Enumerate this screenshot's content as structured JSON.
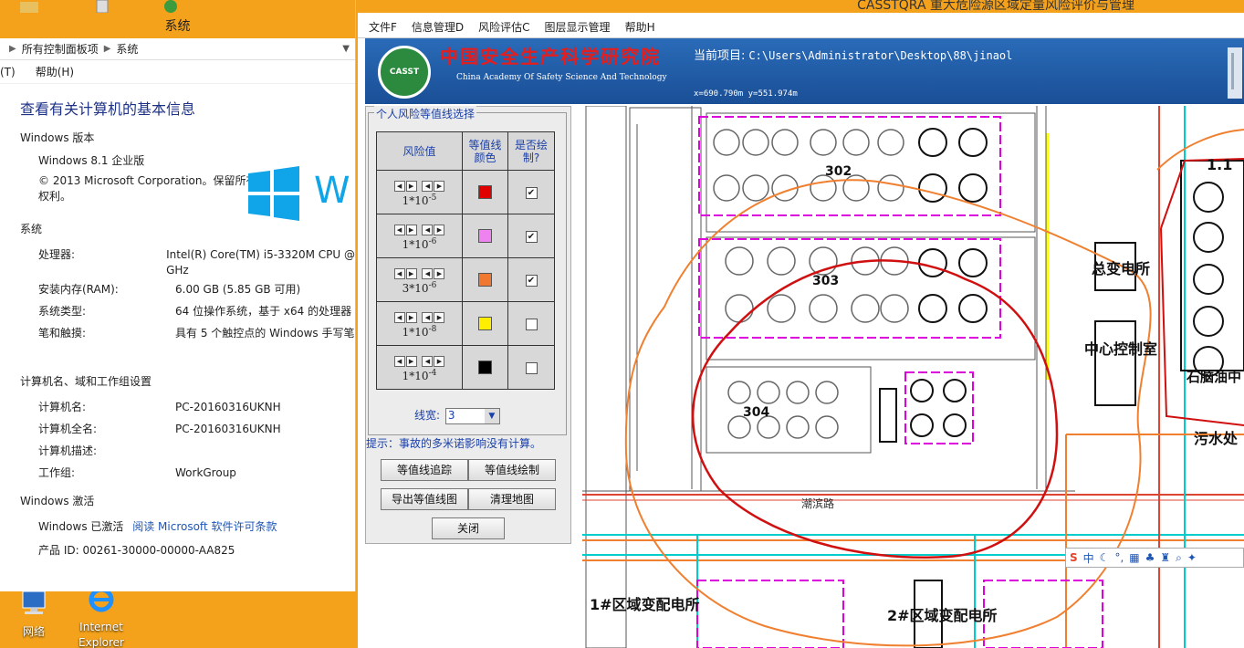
{
  "desktop": {
    "icons": [
      {
        "label": "网络"
      },
      {
        "label": "Internet\nExplorer"
      }
    ]
  },
  "system": {
    "window_title": "系统",
    "breadcrumb": [
      "所有控制面板项",
      "系统"
    ],
    "menu": [
      "(T)",
      "帮助(H)"
    ],
    "heading": "查看有关计算机的基本信息",
    "edition_section": "Windows 版本",
    "edition": "Windows 8.1 企业版",
    "copyright": "© 2013 Microsoft Corporation。保留所有权利。",
    "logo_partial": "W",
    "system_section": "系统",
    "system_rows": [
      {
        "k": "处理器:",
        "v": "Intel(R) Core(TM) i5-3320M CPU @",
        "v2": "GHz"
      },
      {
        "k": "安装内存(RAM):",
        "v": "6.00 GB (5.85 GB 可用)"
      },
      {
        "k": "系统类型:",
        "v": "64 位操作系统，基于 x64 的处理器"
      },
      {
        "k": "笔和触摸:",
        "v": "具有 5 个触控点的 Windows 手写笔"
      }
    ],
    "computer_section": "计算机名、域和工作组设置",
    "computer_rows": [
      {
        "k": "计算机名:",
        "v": "PC-20160316UKNH"
      },
      {
        "k": "计算机全名:",
        "v": "PC-20160316UKNH"
      },
      {
        "k": "计算机描述:",
        "v": ""
      },
      {
        "k": "工作组:",
        "v": "WorkGroup"
      }
    ],
    "activation_section": "Windows 激活",
    "activated": "Windows 已激活",
    "license_link": "阅读 Microsoft 软件许可条款",
    "product_id": "产品 ID: 00261-30000-00000-AA825"
  },
  "app": {
    "title": "CASSTQRA 重大危险源区域定量风险评价与管理",
    "menu": [
      "文件F",
      "信息管理D",
      "风险评估C",
      "图层显示管理",
      "帮助H"
    ],
    "logo_text": "CASST",
    "org_cn": "中国安全生产科学研究院",
    "org_en": "China Academy Of Safety Science And Technology",
    "project_label": "当前项目:",
    "project_path": "C:\\Users\\Administrator\\Desktop\\88\\jinaol",
    "coords": "x=690.790m  y=551.974m",
    "panel": {
      "group_label": "个人风险等值线选择",
      "col_risk": "风险值",
      "col_color": "等值线颜色",
      "col_draw": "是否绘制?",
      "rows": [
        {
          "coef": "1*10",
          "exp": "-5",
          "color": "#e00000",
          "checked": true
        },
        {
          "coef": "1*10",
          "exp": "-6",
          "color": "#ee82ee",
          "checked": true
        },
        {
          "coef": "3*10",
          "exp": "-6",
          "color": "#f07830",
          "checked": true
        },
        {
          "coef": "1*10",
          "exp": "-8",
          "color": "#ffee00",
          "checked": false
        },
        {
          "coef": "1*10",
          "exp": "-4",
          "color": "#000000",
          "checked": false
        }
      ],
      "line_width_label": "线宽:",
      "line_width_value": "3",
      "hint": "提示：事故的多米诺影响没有计算。",
      "buttons": {
        "trace": "等值线追踪",
        "draw": "等值线绘制",
        "export": "导出等值线图",
        "clear": "清理地图",
        "close": "关闭"
      }
    },
    "map_labels": {
      "tank302": "302",
      "tank303": "303",
      "tank304": "304",
      "substation_top": "总变电所",
      "control": "中心控制室",
      "road": "潮滨路",
      "sub1": "1#区域变配电所",
      "sub2": "2#区域变配电所",
      "sewage": "污水处",
      "oil_tank": "石脑油中",
      "right_top": "1.1"
    },
    "ime_text": "中"
  }
}
